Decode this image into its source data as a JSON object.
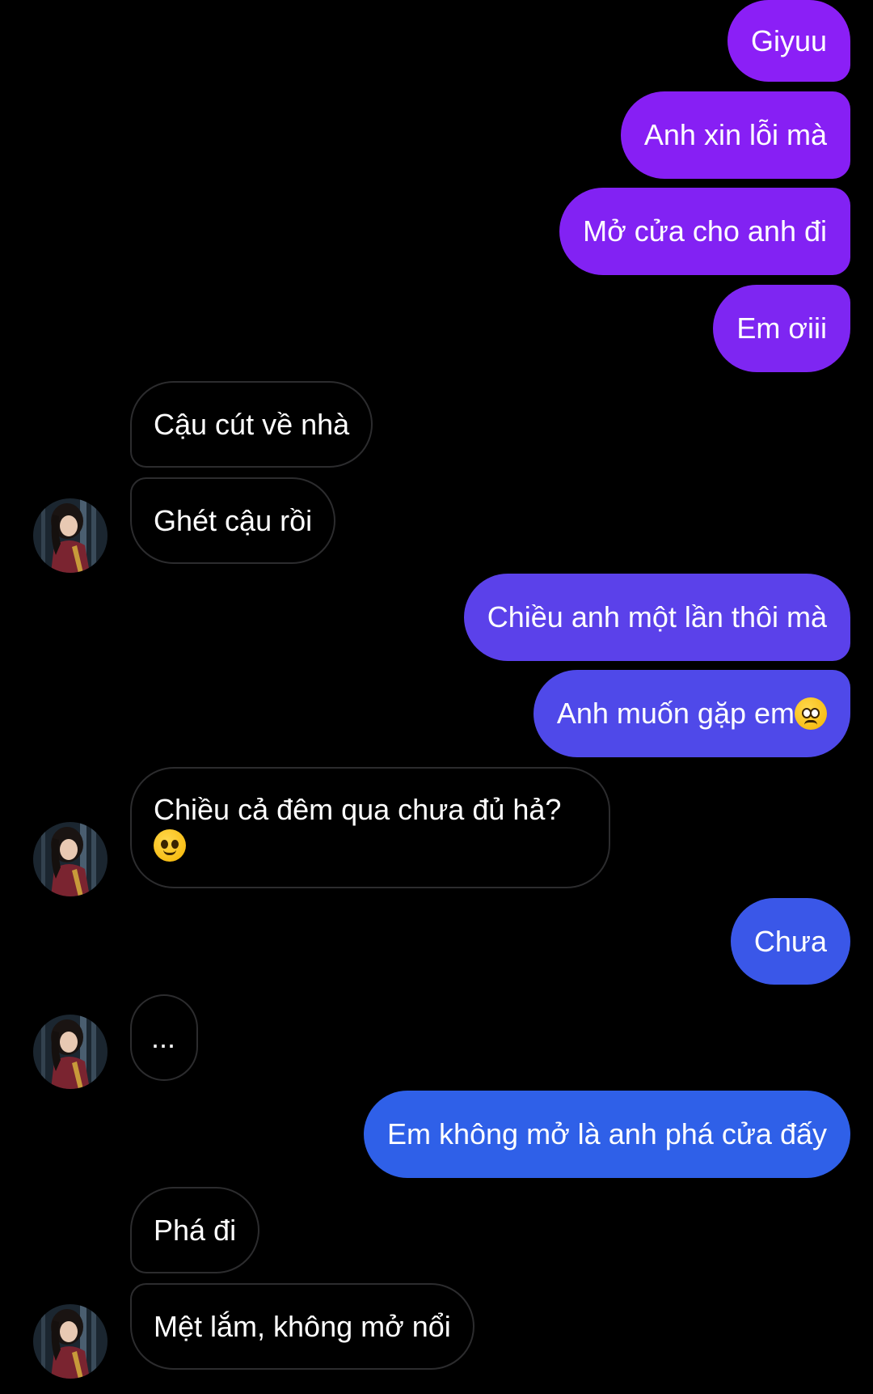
{
  "colors": {
    "background": "#000000",
    "incoming_border": "#2c2c2e",
    "gradient_top": "#8a1ef5",
    "gradient_bottom": "#2d63e8"
  },
  "messages": [
    {
      "dir": "out",
      "text": "Giyuu",
      "color": "#8b1ff6"
    },
    {
      "dir": "out",
      "text": "Anh xin lỗi mà",
      "color": "#871ff4"
    },
    {
      "dir": "out",
      "text": "Mở cửa cho anh đi",
      "color": "#8222f3"
    },
    {
      "dir": "out",
      "text": "Em ơiii",
      "color": "#7e26f2"
    },
    {
      "dir": "in",
      "text": "Cậu cút về nhà"
    },
    {
      "dir": "in",
      "text": "Ghét cậu rồi"
    },
    {
      "dir": "out",
      "text": "Chiều anh một lần thôi mà",
      "color": "#5b41ea"
    },
    {
      "dir": "out",
      "text": "Anh muốn gặp em",
      "emoji": "pleading-face-emoji",
      "color": "#4f49e9"
    },
    {
      "dir": "in",
      "text": "Chiều cả đêm qua chưa đủ hả?",
      "emoji": "slight-smile-emoji"
    },
    {
      "dir": "out",
      "text": "Chưa",
      "color": "#3a57e8"
    },
    {
      "dir": "in",
      "text": "..."
    },
    {
      "dir": "out",
      "text": "Em không mở là anh phá cửa đấy",
      "color": "#2f60e8"
    },
    {
      "dir": "in",
      "text": "Phá đi"
    },
    {
      "dir": "in",
      "text": "Mệt lắm, không mở nổi"
    }
  ]
}
